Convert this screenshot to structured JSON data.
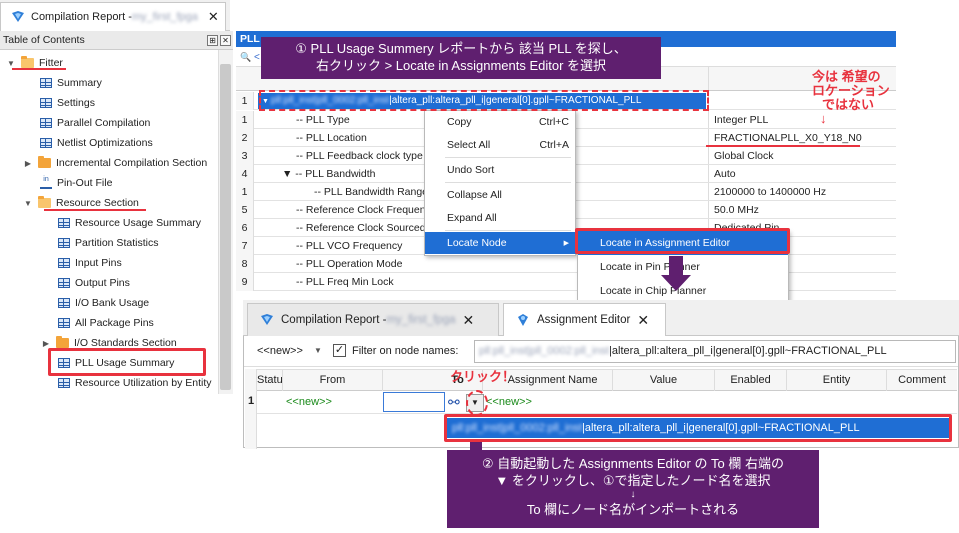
{
  "window1": {
    "tab_label": "Compilation Report - ",
    "tab_project": "my_first_fpga",
    "close_glyph": "✕"
  },
  "toc": {
    "title": "Table of Contents",
    "pin_glyph": "⊞",
    "close_glyph": "✕",
    "items": [
      {
        "label": "Fitter",
        "icon": "folder-open-icon",
        "expander": "▼"
      },
      {
        "label": "Summary",
        "icon": "table-icon"
      },
      {
        "label": "Settings",
        "icon": "table-icon"
      },
      {
        "label": "Parallel Compilation",
        "icon": "table-icon"
      },
      {
        "label": "Netlist Optimizations",
        "icon": "table-icon"
      },
      {
        "label": "Incremental Compilation Section",
        "icon": "folder-icon",
        "expander": "▶"
      },
      {
        "label": "Pin-Out File",
        "icon": "pin-file-icon"
      },
      {
        "label": "Resource Section",
        "icon": "folder-open-icon",
        "expander": "▼"
      },
      {
        "label": "Resource Usage Summary",
        "icon": "table-icon"
      },
      {
        "label": "Partition Statistics",
        "icon": "table-icon"
      },
      {
        "label": "Input Pins",
        "icon": "table-icon"
      },
      {
        "label": "Output Pins",
        "icon": "table-icon"
      },
      {
        "label": "I/O Bank Usage",
        "icon": "table-icon"
      },
      {
        "label": "All Package Pins",
        "icon": "table-icon"
      },
      {
        "label": "I/O Standards Section",
        "icon": "folder-icon",
        "expander": "▶"
      },
      {
        "label": "PLL Usage Summary",
        "icon": "table-icon"
      },
      {
        "label": "Resource Utilization by Entity",
        "icon": "table-icon"
      }
    ]
  },
  "grid": {
    "title": "PLL",
    "search_glyph": "🔍",
    "search_text": "<",
    "row1_num": "1",
    "row1_blur": "pll:pll_inst|pll_0002:pll_inst",
    "row1_text": "|altera_pll:altera_pll_i|general[0].gpll~FRACTIONAL_PLL",
    "rows": [
      {
        "num": "1",
        "name": "-- PLL Type",
        "value": "Integer PLL"
      },
      {
        "num": "2",
        "name": "-- PLL Location",
        "value": "FRACTIONALPLL_X0_Y18_N0"
      },
      {
        "num": "3",
        "name": "-- PLL Feedback clock type",
        "value": "Global Clock"
      },
      {
        "num": "4",
        "name": "▼ -- PLL Bandwidth",
        "value": "Auto"
      },
      {
        "num": "1",
        "name": "-- PLL Bandwidth Range",
        "value": "2100000 to 1400000 Hz"
      },
      {
        "num": "5",
        "name": "-- Reference Clock Frequency",
        "value": "50.0 MHz"
      },
      {
        "num": "6",
        "name": "-- Reference Clock Sourced by",
        "value": "Dedicated Pin"
      },
      {
        "num": "7",
        "name": "-- PLL VCO Frequency",
        "value": ""
      },
      {
        "num": "8",
        "name": "-- PLL Operation Mode",
        "value": ""
      },
      {
        "num": "9",
        "name": "-- PLL Freq Min Lock",
        "value": ""
      }
    ]
  },
  "context_menu": {
    "items": [
      {
        "label": "Copy",
        "shortcut": "Ctrl+C"
      },
      {
        "label": "Select All",
        "shortcut": "Ctrl+A"
      },
      {
        "label": "Undo Sort",
        "shortcut": ""
      },
      {
        "label": "Collapse All",
        "shortcut": ""
      },
      {
        "label": "Expand All",
        "shortcut": ""
      },
      {
        "label": "Locate Node",
        "shortcut": "▶"
      }
    ],
    "submenu": [
      "Locate in Assignment Editor",
      "Locate in Pin Planner",
      "Locate in Chip Planner"
    ]
  },
  "window2": {
    "tab1_label": "Compilation Report - ",
    "tab1_project": "my_first_fpga",
    "tab2_label": "Assignment Editor",
    "close_glyph": "✕",
    "new_dropdown": "<<new>>",
    "dropdown_arrow": "▼",
    "filter_check": "✓",
    "filter_label": "Filter on node names:",
    "filter_blur": "pll:pll_inst|pll_0002:pll_inst",
    "filter_value": "|altera_pll:altera_pll_i|general[0].gpll~FRACTIONAL_PLL",
    "columns": [
      "Status",
      "From",
      "To",
      "Assignment Name",
      "Value",
      "Enabled",
      "Entity",
      "Comment"
    ],
    "row_num": "1",
    "row_from": "<<new>>",
    "row_assignment": "<<new>>",
    "node_finder_glyph": "⚯",
    "dropdown_item_blur": "pll:pll_inst|pll_0002:pll_inst",
    "dropdown_item": "|altera_pll:altera_pll_i|general[0].gpll~FRACTIONAL_PLL"
  },
  "annotations": {
    "callout1_line1": "① PLL Usage Summery レポートから 該当 PLL を探し、",
    "callout1_line2": "右クリック > Locate in Assignments Editor を選択",
    "note_line1": "今は 希望の",
    "note_line2": "ロケーション",
    "note_line3": "ではない",
    "note_arrow": "↓",
    "click_label": "クリック！",
    "callout2_line1": "② 自動起動した Assignments Editor の To 欄 右端の",
    "callout2_line2": "▼ をクリックし、①で指定したノード名を選択",
    "callout2_arrow": "↓",
    "callout2_line3": "To 欄にノード名がインポートされる"
  },
  "colors": {
    "accent": "#1f6ed4",
    "callout": "#5f1f6f",
    "highlight": "#e8323e"
  }
}
